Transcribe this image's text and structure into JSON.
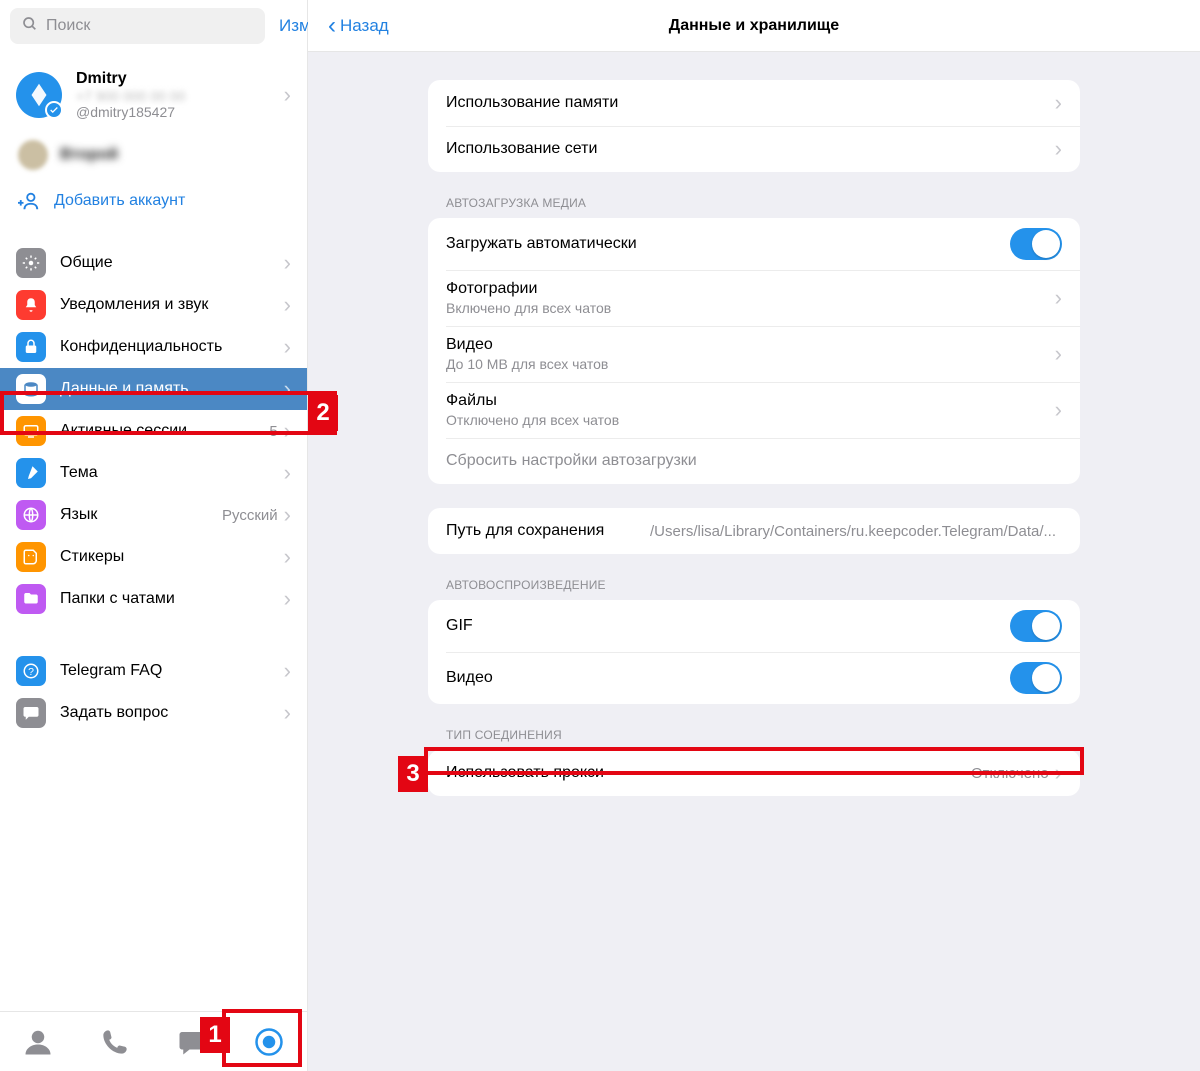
{
  "sidebar": {
    "search_placeholder": "Поиск",
    "edit_label": "Изм.",
    "profile": {
      "name": "Dmitry",
      "handle": "@dmitry185427",
      "blurred_line": "+7 900 000 00 00"
    },
    "second_account": "Второй",
    "add_account_label": "Добавить аккаунт",
    "items": [
      {
        "label": "Общие",
        "icon": "gear",
        "color": "#8e8e93"
      },
      {
        "label": "Уведомления и звук",
        "icon": "bell",
        "color": "#fe3b30"
      },
      {
        "label": "Конфиденциальность",
        "icon": "lock",
        "color": "#2492eb"
      },
      {
        "label": "Данные и память",
        "icon": "storage",
        "color": "#2492eb",
        "active": true
      },
      {
        "label": "Активные сессии",
        "icon": "sessions",
        "color": "#ff9500",
        "value": "5"
      },
      {
        "label": "Тема",
        "icon": "brush",
        "color": "#2492eb"
      },
      {
        "label": "Язык",
        "icon": "globe",
        "color": "#bf5af2",
        "value": "Русский"
      },
      {
        "label": "Стикеры",
        "icon": "sticker",
        "color": "#ff9500"
      },
      {
        "label": "Папки с чатами",
        "icon": "folder",
        "color": "#bf5af2"
      }
    ],
    "help": [
      {
        "label": "Telegram FAQ",
        "icon": "faq",
        "color": "#2492eb"
      },
      {
        "label": "Задать вопрос",
        "icon": "chat",
        "color": "#8e8e93"
      }
    ]
  },
  "main": {
    "back_label": "Назад",
    "title": "Данные и хранилище",
    "usage": {
      "memory": "Использование памяти",
      "network": "Использование сети"
    },
    "autodownload_header": "АВТОЗАГРУЗКА МЕДИА",
    "autodownload": {
      "auto_label": "Загружать автоматически",
      "photos_label": "Фотографии",
      "photos_sub": "Включено для всех чатов",
      "videos_label": "Видео",
      "videos_sub": "До 10 MB для всех чатов",
      "files_label": "Файлы",
      "files_sub": "Отключено для всех чатов",
      "reset_label": "Сбросить настройки автозагрузки"
    },
    "save_path_label": "Путь для сохранения",
    "save_path_value": "/Users/lisa/Library/Containers/ru.keepcoder.Telegram/Data/...",
    "autoplay_header": "АВТОВОСПРОИЗВЕДЕНИЕ",
    "autoplay": {
      "gif_label": "GIF",
      "video_label": "Видео"
    },
    "connection_header": "ТИП СОЕДИНЕНИЯ",
    "proxy_label": "Использовать прокси",
    "proxy_value": "Отключено"
  },
  "annotations": {
    "n1": "1",
    "n2": "2",
    "n3": "3"
  }
}
